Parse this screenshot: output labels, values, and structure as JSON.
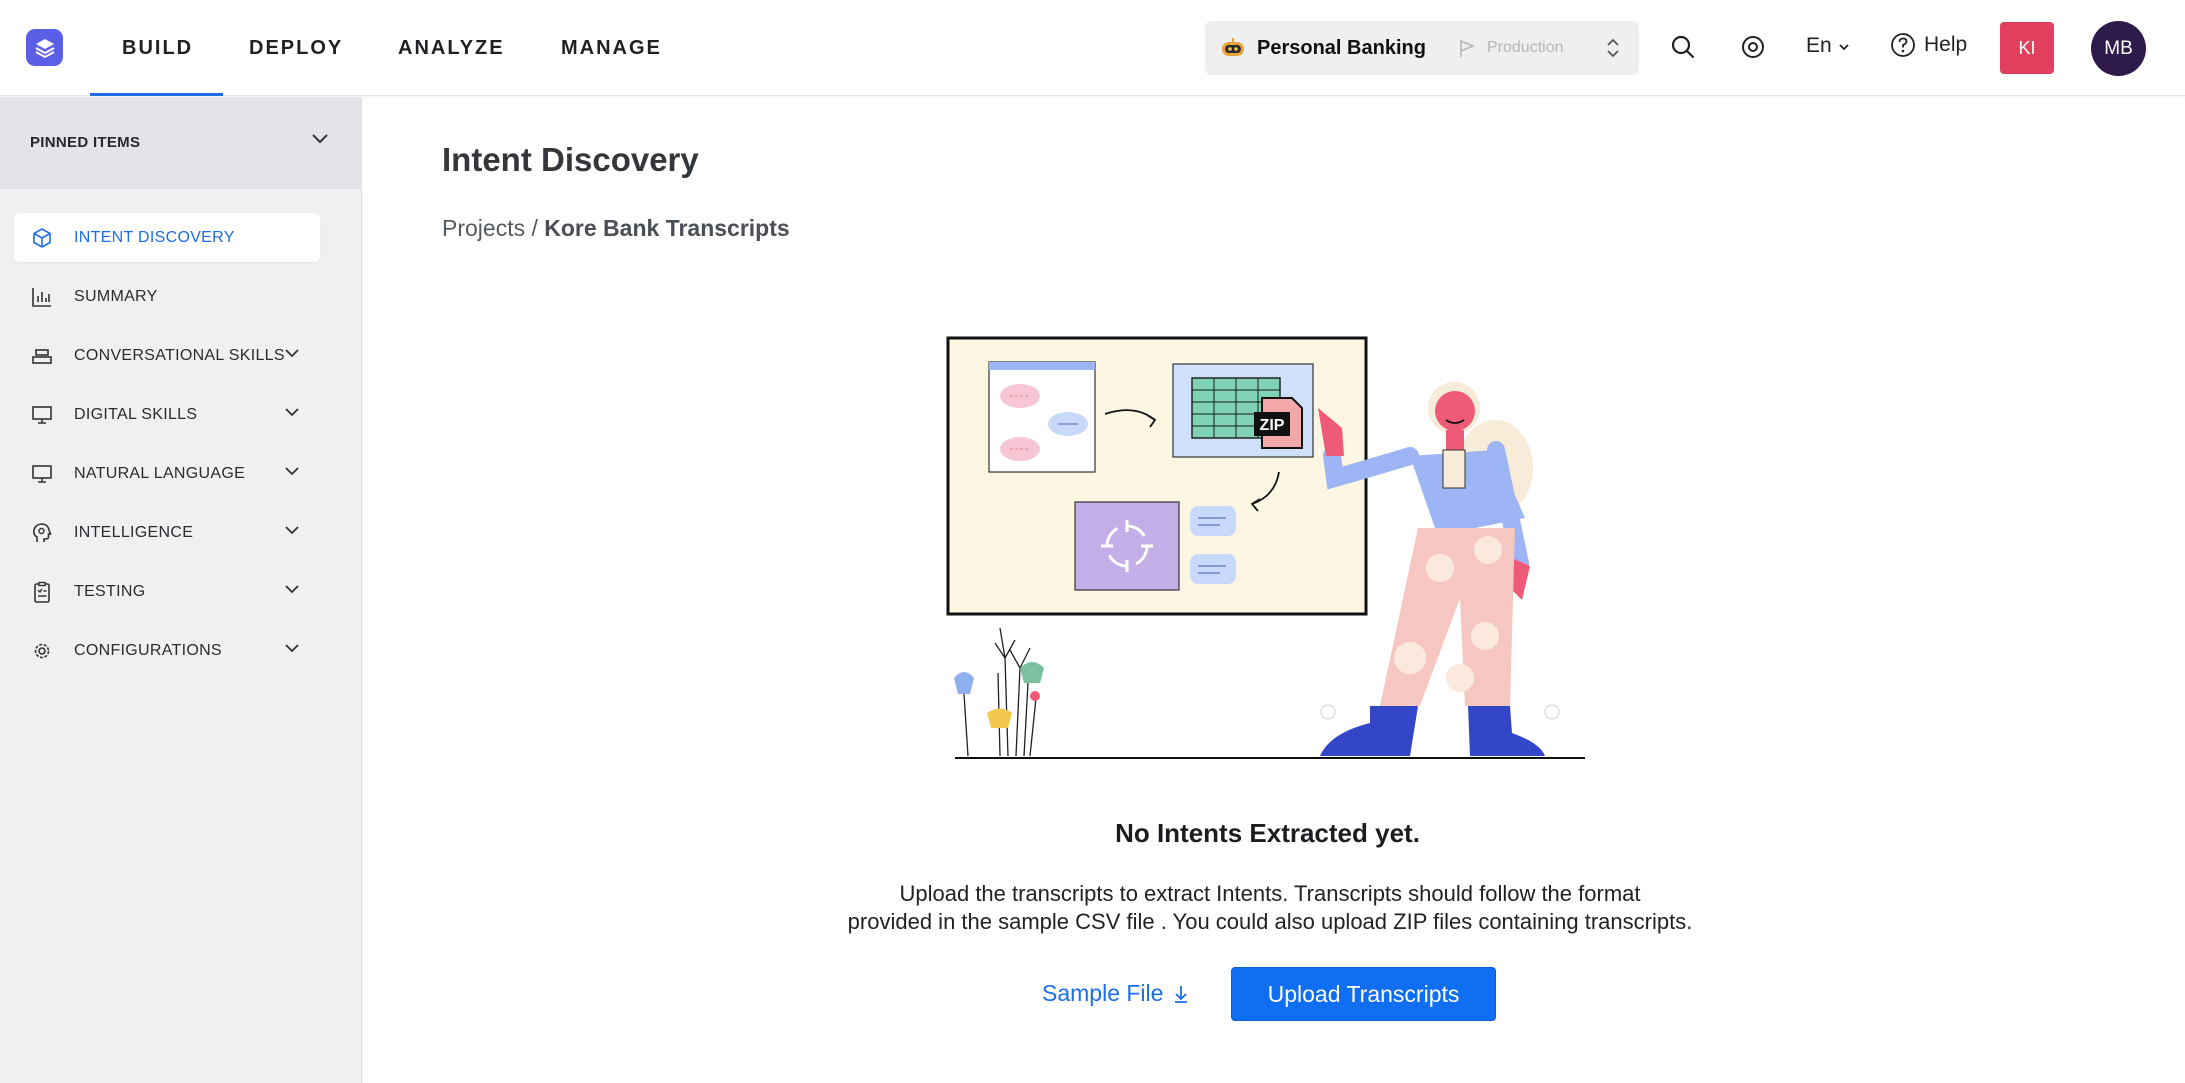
{
  "header": {
    "nav": [
      "BUILD",
      "DEPLOY",
      "ANALYZE",
      "MANAGE"
    ],
    "active_nav": "BUILD",
    "bot_name": "Personal Banking",
    "environment": "Production",
    "language": "En",
    "help_label": "Help",
    "user_initials_1": "KI",
    "user_initials_2": "MB"
  },
  "sidebar": {
    "pinned_label": "PINNED ITEMS",
    "items": [
      {
        "label": "INTENT DISCOVERY",
        "icon": "cube-icon",
        "active": true,
        "expandable": false
      },
      {
        "label": "SUMMARY",
        "icon": "bar-chart-icon",
        "active": false,
        "expandable": false
      },
      {
        "label": "CONVERSATIONAL SKILLS",
        "icon": "stack-icon",
        "active": false,
        "expandable": true
      },
      {
        "label": "DIGITAL SKILLS",
        "icon": "monitor-icon",
        "active": false,
        "expandable": true
      },
      {
        "label": "NATURAL LANGUAGE",
        "icon": "monitor-icon",
        "active": false,
        "expandable": true
      },
      {
        "label": "INTELLIGENCE",
        "icon": "brain-icon",
        "active": false,
        "expandable": true
      },
      {
        "label": "TESTING",
        "icon": "clipboard-icon",
        "active": false,
        "expandable": true
      },
      {
        "label": "CONFIGURATIONS",
        "icon": "gear-icon",
        "active": false,
        "expandable": true
      }
    ]
  },
  "main": {
    "title": "Intent Discovery",
    "breadcrumb_root": "Projects",
    "breadcrumb_sep": "/",
    "breadcrumb_current": "Kore Bank Transcripts",
    "illustration_zip_label": "ZIP",
    "empty_title": "No Intents Extracted yet.",
    "empty_desc_line1": "Upload the transcripts to extract Intents. Transcripts should follow the format",
    "empty_desc_line2": "provided in the sample CSV file . You could also upload ZIP files containing transcripts.",
    "sample_file_label": "Sample File",
    "upload_button_label": "Upload Transcripts"
  },
  "colors": {
    "accent": "#1c6ee8",
    "primary_button": "#0f6ef2",
    "logo": "#5b5fe8",
    "avatar_ki": "#e0405e",
    "avatar_mb": "#2e1b4c"
  }
}
